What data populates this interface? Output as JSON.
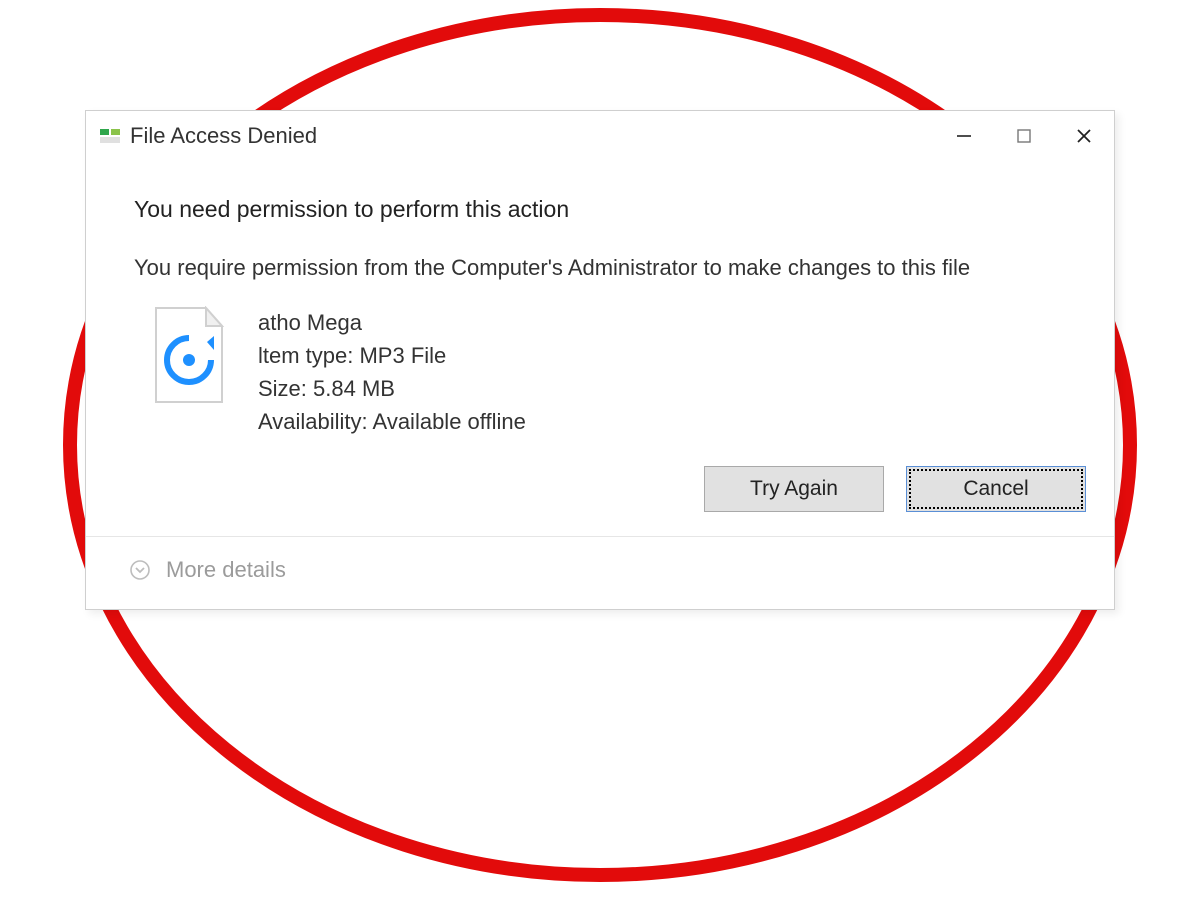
{
  "window": {
    "title": "File Access Denied"
  },
  "message": {
    "headline": "You need permission to perform this action",
    "explain": "You require permission from the Computer's Administrator to make changes to this file"
  },
  "file": {
    "name": "atho Mega",
    "type_label": "ltem type: MP3 File",
    "size_label": "Size: 5.84 MB",
    "availability_label": "Availability: Available offline"
  },
  "buttons": {
    "try_again": "Try Again",
    "cancel": "Cancel"
  },
  "footer": {
    "more_details": "More details"
  }
}
